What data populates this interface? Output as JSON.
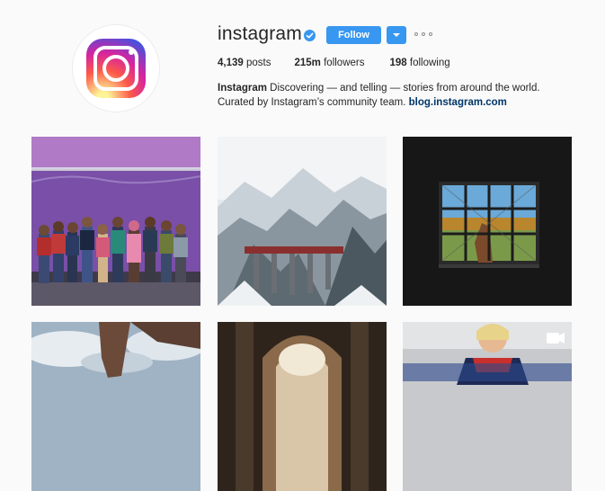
{
  "profile": {
    "username": "instagram",
    "follow_label": "Follow",
    "stats": {
      "posts_count": "4,139",
      "posts_label": "posts",
      "followers_count": "215m",
      "followers_label": "followers",
      "following_count": "198",
      "following_label": "following"
    },
    "bio": {
      "name": "Instagram",
      "text": "Discovering — and telling — stories from around the world. Curated by Instagram’s community team.",
      "link": "blog.instagram.com"
    }
  },
  "colors": {
    "accent": "#3897f0",
    "link": "#003569",
    "background": "#fafafa"
  },
  "icons": [
    "instagram-logo-icon",
    "verified-badge-icon",
    "chevron-down-icon",
    "more-options-icon",
    "video-icon"
  ],
  "posts": [
    {
      "description": "group on purple wall"
    },
    {
      "description": "snowy mountain train viaduct"
    },
    {
      "description": "horse through window"
    },
    {
      "description": "hand and cloudy sky"
    },
    {
      "description": "cathedral interior"
    },
    {
      "description": "cheerleader video",
      "type": "video"
    }
  ]
}
